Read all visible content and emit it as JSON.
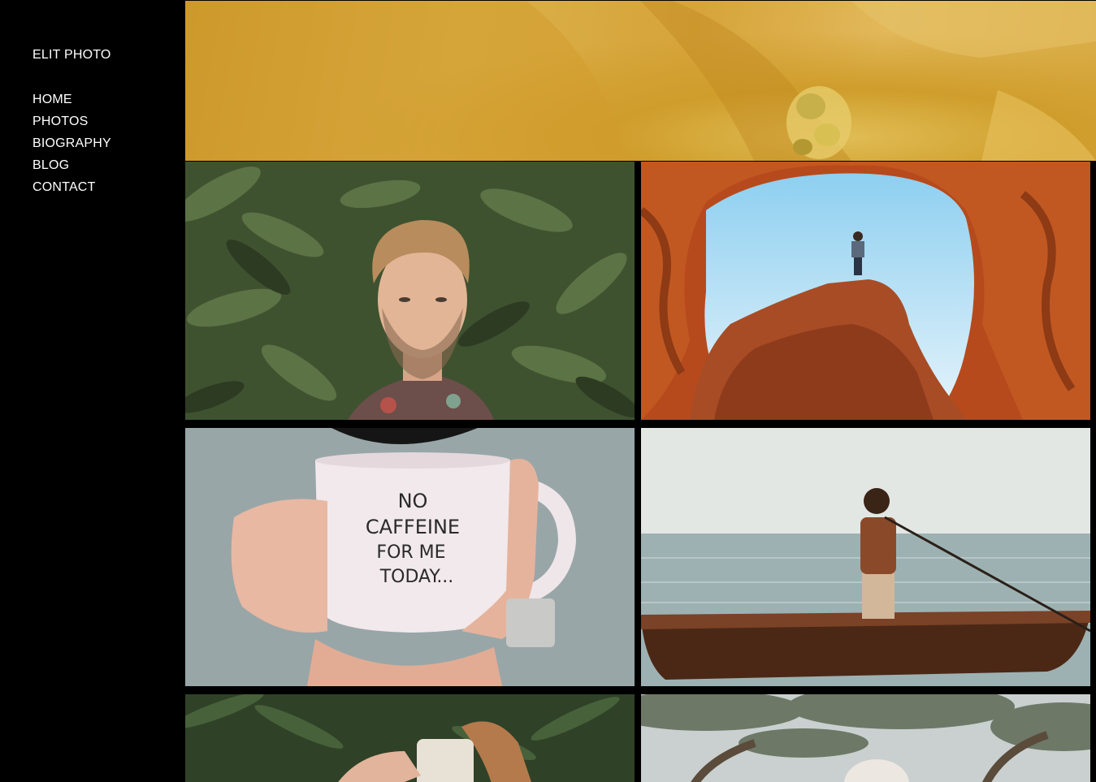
{
  "brand": "ELIT PHOTO",
  "nav": [
    {
      "label": "HOME"
    },
    {
      "label": "PHOTOS"
    },
    {
      "label": "BIOGRAPHY"
    },
    {
      "label": "BLOG"
    },
    {
      "label": "CONTACT"
    }
  ],
  "gallery": {
    "photos": [
      {
        "name": "yellow-flower-macro"
      },
      {
        "name": "young-man-among-leaves"
      },
      {
        "name": "man-on-rock-in-cave-arch"
      },
      {
        "name": "hands-holding-mug"
      },
      {
        "name": "boy-on-wooden-boat"
      },
      {
        "name": "coffee-splash"
      },
      {
        "name": "woman-under-tree"
      }
    ],
    "mug_text": [
      "NO",
      "CAFFEINE",
      "FOR ME",
      "TODAY..."
    ]
  }
}
